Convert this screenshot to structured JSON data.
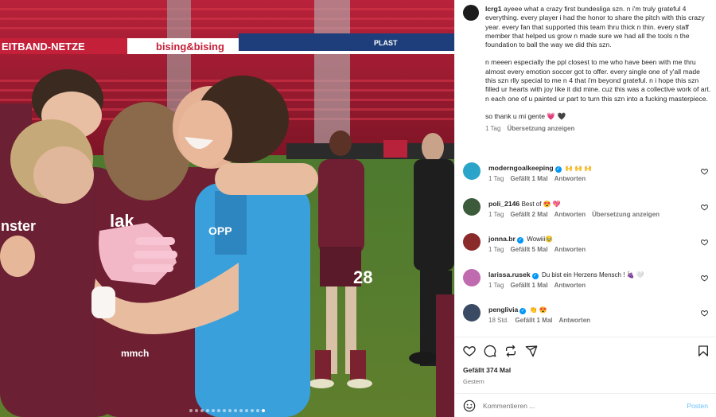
{
  "post": {
    "author": "lcrg1",
    "caption_paragraphs": [
      "ayeee what a crazy first bundesliga szn. n i'm truly grateful 4 everything. every player i had the honor to share the pitch with this crazy year. every fan that supported this team thru thick n thin. every staff member that helped us grow n made sure we had all the tools n the foundation to ball the way we did this szn.",
      "n meeen especially the ppl closest to me who have been with me thru almost every emotion soccer got to offer. every single one of y'all made this szn rlly special to me n 4 that i'm beyond grateful. n i hope this szn filled ur hearts with joy like it did mine. cuz this was a collective work of art. n each one of u painted ur part to turn this szn into a fucking masterpiece.",
      "so thank u mi gente 💗 🖤"
    ],
    "time": "1 Tag",
    "translate": "Übersetzung anzeigen",
    "likes": "Gefällt 374 Mal",
    "date": "Gestern"
  },
  "banner_texts": [
    "EITBAND-NETZE",
    "bising&bising",
    "PLAST"
  ],
  "comments": [
    {
      "user": "moderngoalkeeping",
      "verified": true,
      "text": "🙌 🙌 🙌",
      "time": "1 Tag",
      "likes": "Gefällt 1 Mal",
      "reply": "Antworten",
      "extra": "",
      "avatar_color": "#2aa5c9"
    },
    {
      "user": "poli_2146",
      "verified": false,
      "text": "Best of 😍 💖",
      "time": "1 Tag",
      "likes": "Gefällt 2 Mal",
      "reply": "Antworten",
      "extra": "Übersetzung anzeigen",
      "avatar_color": "#3c5b3a"
    },
    {
      "user": "jonna.br",
      "verified": true,
      "text": "Wowiii🥹",
      "time": "1 Tag",
      "likes": "Gefällt 5 Mal",
      "reply": "Antworten",
      "extra": "",
      "avatar_color": "#8a2a2a"
    },
    {
      "user": "larissa.rusek",
      "verified": true,
      "text": "Du bist ein Herzens Mensch ! 🍇 🤍",
      "time": "1 Tag",
      "likes": "Gefällt 1 Mal",
      "reply": "Antworten",
      "extra": "",
      "avatar_color": "#c06ab0"
    },
    {
      "user": "penglivia",
      "verified": true,
      "text": "👏 😍",
      "time": "18 Std.",
      "likes": "Gefällt 1 Mal",
      "reply": "Antworten",
      "extra": "",
      "avatar_color": "#3a4a63"
    }
  ],
  "comment_box": {
    "placeholder": "Kommentieren ...",
    "post_label": "Posten"
  },
  "carousel": {
    "count": 14,
    "active": 13
  }
}
